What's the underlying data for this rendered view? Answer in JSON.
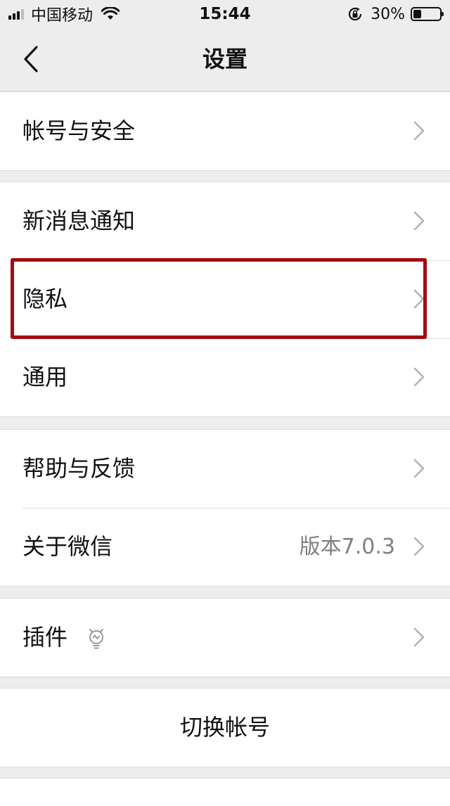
{
  "status_bar": {
    "carrier": "中国移动",
    "time": "15:44",
    "battery_percent": "30%",
    "battery_level": 0.3,
    "signal_icon": "signal-icon",
    "wifi_icon": "wifi-icon",
    "lock_icon": "rotation-lock-icon"
  },
  "nav": {
    "title": "设置",
    "back_icon": "chevron-left-icon"
  },
  "groups": [
    {
      "items": [
        {
          "label": "帐号与安全"
        }
      ]
    },
    {
      "items": [
        {
          "label": "新消息通知"
        },
        {
          "label": "隐私"
        },
        {
          "label": "通用"
        }
      ]
    },
    {
      "items": [
        {
          "label": "帮助与反馈"
        },
        {
          "label": "关于微信",
          "value": "版本7.0.3"
        }
      ]
    },
    {
      "items": [
        {
          "label": "插件",
          "icon": "plugin-bulb-icon"
        }
      ]
    }
  ],
  "switch_account": {
    "label": "切换帐号"
  },
  "colors": {
    "background": "#ededed",
    "cell": "#ffffff",
    "highlight": "#a20d12",
    "secondary_text": "#808080",
    "chevron": "#b2b2b2"
  }
}
